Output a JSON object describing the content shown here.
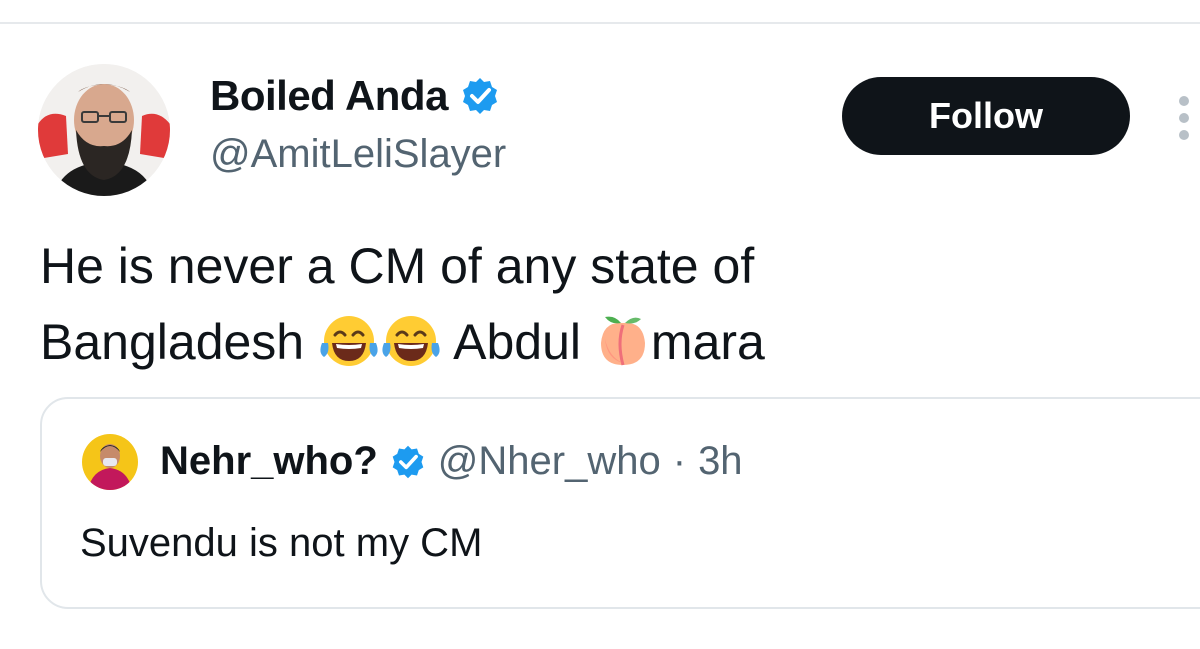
{
  "tweet": {
    "author": {
      "display_name": "Boiled Anda",
      "handle": "@AmitLeliSlayer",
      "verified": true,
      "avatar_icon": "bearded-man-avatar"
    },
    "follow_label": "Follow",
    "text_line1": "He is never a CM of any state of",
    "text_line2_part1": "Bangladesh ",
    "text_line2_part2": " Abdul ",
    "text_line2_part3": "mara",
    "emojis": [
      "face-with-tears-of-joy",
      "face-with-tears-of-joy",
      "peach"
    ]
  },
  "quoted_tweet": {
    "display_name": "Nehr_who?",
    "handle": "@Nher_who",
    "separator": "·",
    "time": "3h",
    "verified": true,
    "avatar_icon": "person-avatar",
    "text": "Suvendu is not my CM"
  },
  "colors": {
    "verified_blue": "#1d9bf0",
    "follow_bg": "#0f1419",
    "secondary_text": "#536471",
    "border": "#e1e6ea"
  }
}
